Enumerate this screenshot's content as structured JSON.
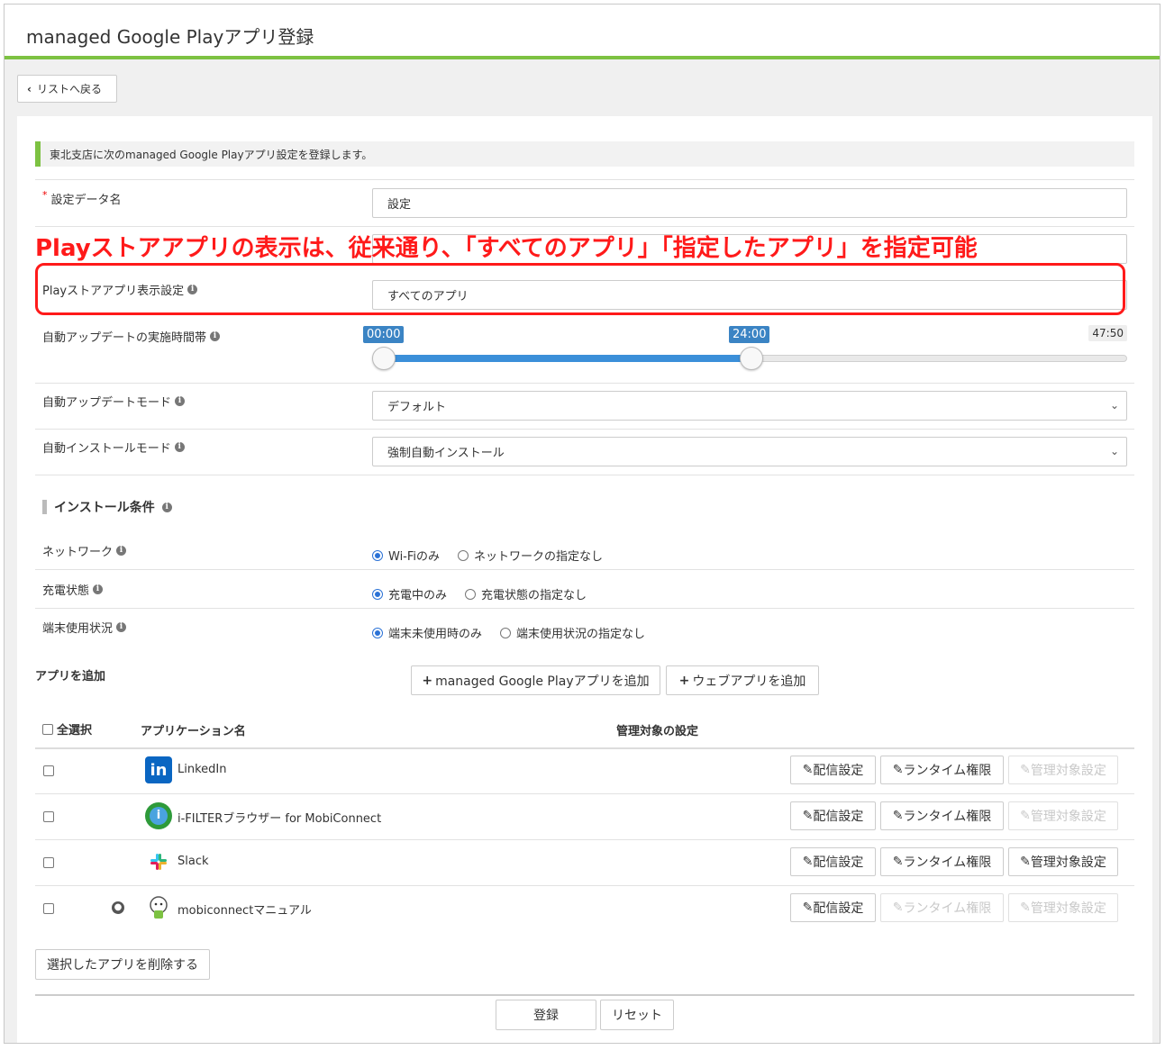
{
  "page": {
    "title": "managed Google Playアプリ登録",
    "back_label": "リストへ戻る"
  },
  "notice": "東北支店に次のmanaged Google Playアプリ設定を登録します。",
  "callout": "Playストアアプリの表示は、従来通り、「すべてのアプリ」「指定したアプリ」を指定可能",
  "form": {
    "name_label": "設定データ名",
    "name_required": "*",
    "name_value": "設定",
    "play_label": "Playストアアプリ表示設定",
    "play_value": "すべてのアプリ",
    "update_time_label": "自動アップデートの実施時間帯",
    "update_time_start": "00:00",
    "update_time_end": "24:00",
    "update_time_max": "47:50",
    "update_mode_label": "自動アップデートモード",
    "update_mode_value": "デフォルト",
    "install_mode_label": "自動インストールモード",
    "install_mode_value": "強制自動インストール"
  },
  "install_conditions": {
    "heading": "インストール条件",
    "network_label": "ネットワーク",
    "network_opt1": "Wi-Fiのみ",
    "network_opt2": "ネットワークの指定なし",
    "charge_label": "充電状態",
    "charge_opt1": "充電中のみ",
    "charge_opt2": "充電状態の指定なし",
    "usage_label": "端末使用状況",
    "usage_opt1": "端末未使用時のみ",
    "usage_opt2": "端末使用状況の指定なし"
  },
  "apps": {
    "add_label": "アプリを追加",
    "add_play_button": "managed Google Playアプリを追加",
    "add_web_button": "ウェブアプリを追加",
    "select_all": "全選択",
    "col_name": "アプリケーション名",
    "col_manage": "管理対象の設定",
    "btn_delivery": "配信設定",
    "btn_runtime": "ランタイム権限",
    "btn_managed": "管理対象設定",
    "rows": [
      {
        "name": "LinkedIn"
      },
      {
        "name": "i-FILTERブラウザー for MobiConnect"
      },
      {
        "name": "Slack"
      },
      {
        "name": "mobiconnectマニュアル"
      }
    ],
    "delete_button": "選択したアプリを削除する"
  },
  "footer": {
    "submit": "登録",
    "reset": "リセット"
  },
  "colors": {
    "accent": "#7dc242",
    "callout": "#ff1a1a",
    "slider": "#3b8fd9"
  }
}
